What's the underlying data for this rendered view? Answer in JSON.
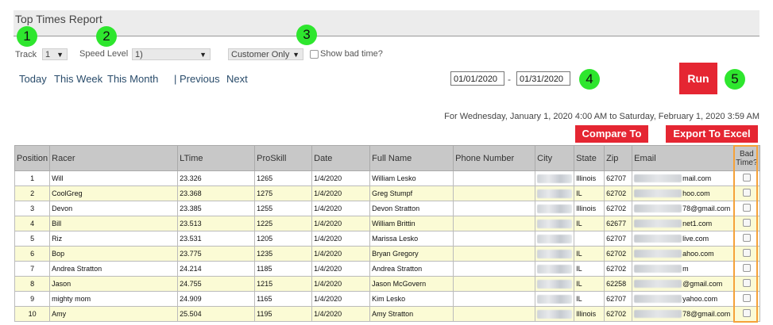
{
  "title": "Top Times Report",
  "badges": [
    "1",
    "2",
    "3",
    "4",
    "5"
  ],
  "filters": {
    "track_label": "Track",
    "track_value": "1",
    "speed_label": "Speed Level",
    "speed_value": "1)",
    "customer_value": "Customer Only",
    "show_bad_label": "Show bad time?"
  },
  "nav": {
    "today": "Today",
    "this_week": "This Week",
    "this_month": "This Month",
    "previous": "| Previous",
    "next": "Next"
  },
  "dates": {
    "start": "01/01/2020",
    "dash": "-",
    "end": "01/31/2020"
  },
  "run_label": "Run",
  "range_text": "For Wednesday, January 1, 2020 4:00 AM to Saturday, February 1, 2020 3:59 AM",
  "compare_label": "Compare To",
  "export_label": "Export To Excel",
  "table": {
    "headers": [
      "Position",
      "Racer",
      "LTime",
      "ProSkill",
      "Date",
      "Full Name",
      "Phone Number",
      "City",
      "State",
      "Zip",
      "Email",
      "Bad Time?"
    ],
    "rows": [
      {
        "pos": "1",
        "racer": "Will",
        "ltime": "23.326",
        "proskill": "1265",
        "date": "1/4/2020",
        "name": "William Lesko",
        "state": "Illinois",
        "zip": "62707",
        "email_suffix": "mail.com"
      },
      {
        "pos": "2",
        "racer": "CoolGreg",
        "ltime": "23.368",
        "proskill": "1275",
        "date": "1/4/2020",
        "name": "Greg Stumpf",
        "state": "IL",
        "zip": "62702",
        "email_suffix": "hoo.com"
      },
      {
        "pos": "3",
        "racer": "Devon",
        "ltime": "23.385",
        "proskill": "1255",
        "date": "1/4/2020",
        "name": "Devon Stratton",
        "state": "Illinois",
        "zip": "62702",
        "email_suffix": "78@gmail.com"
      },
      {
        "pos": "4",
        "racer": "Bill",
        "ltime": "23.513",
        "proskill": "1225",
        "date": "1/4/2020",
        "name": "William Brittin",
        "state": "IL",
        "zip": "62677",
        "email_suffix": "net1.com"
      },
      {
        "pos": "5",
        "racer": "Riz",
        "ltime": "23.531",
        "proskill": "1205",
        "date": "1/4/2020",
        "name": "Marissa Lesko",
        "state": "",
        "zip": "62707",
        "email_suffix": "live.com"
      },
      {
        "pos": "6",
        "racer": "Bop",
        "ltime": "23.775",
        "proskill": "1235",
        "date": "1/4/2020",
        "name": "Bryan Gregory",
        "state": "IL",
        "zip": "62702",
        "email_suffix": "ahoo.com"
      },
      {
        "pos": "7",
        "racer": "Andrea Stratton",
        "ltime": "24.214",
        "proskill": "1185",
        "date": "1/4/2020",
        "name": "Andrea Stratton",
        "state": "IL",
        "zip": "62702",
        "email_suffix": "m"
      },
      {
        "pos": "8",
        "racer": "Jason",
        "ltime": "24.755",
        "proskill": "1215",
        "date": "1/4/2020",
        "name": "Jason McGovern",
        "state": "IL",
        "zip": "62258",
        "email_suffix": "@gmail.com"
      },
      {
        "pos": "9",
        "racer": "mighty mom",
        "ltime": "24.909",
        "proskill": "1165",
        "date": "1/4/2020",
        "name": "Kim Lesko",
        "state": "IL",
        "zip": "62707",
        "email_suffix": "yahoo.com"
      },
      {
        "pos": "10",
        "racer": "Amy",
        "ltime": "25.504",
        "proskill": "1195",
        "date": "1/4/2020",
        "name": "Amy Stratton",
        "state": "Illinois",
        "zip": "62702",
        "email_suffix": "78@gmail.com"
      }
    ]
  },
  "colors": {
    "accent_red": "#e52632",
    "badge_green": "#2ee62e",
    "row_highlight": "#fbfbd5",
    "column_highlight": "#f5a23a"
  }
}
